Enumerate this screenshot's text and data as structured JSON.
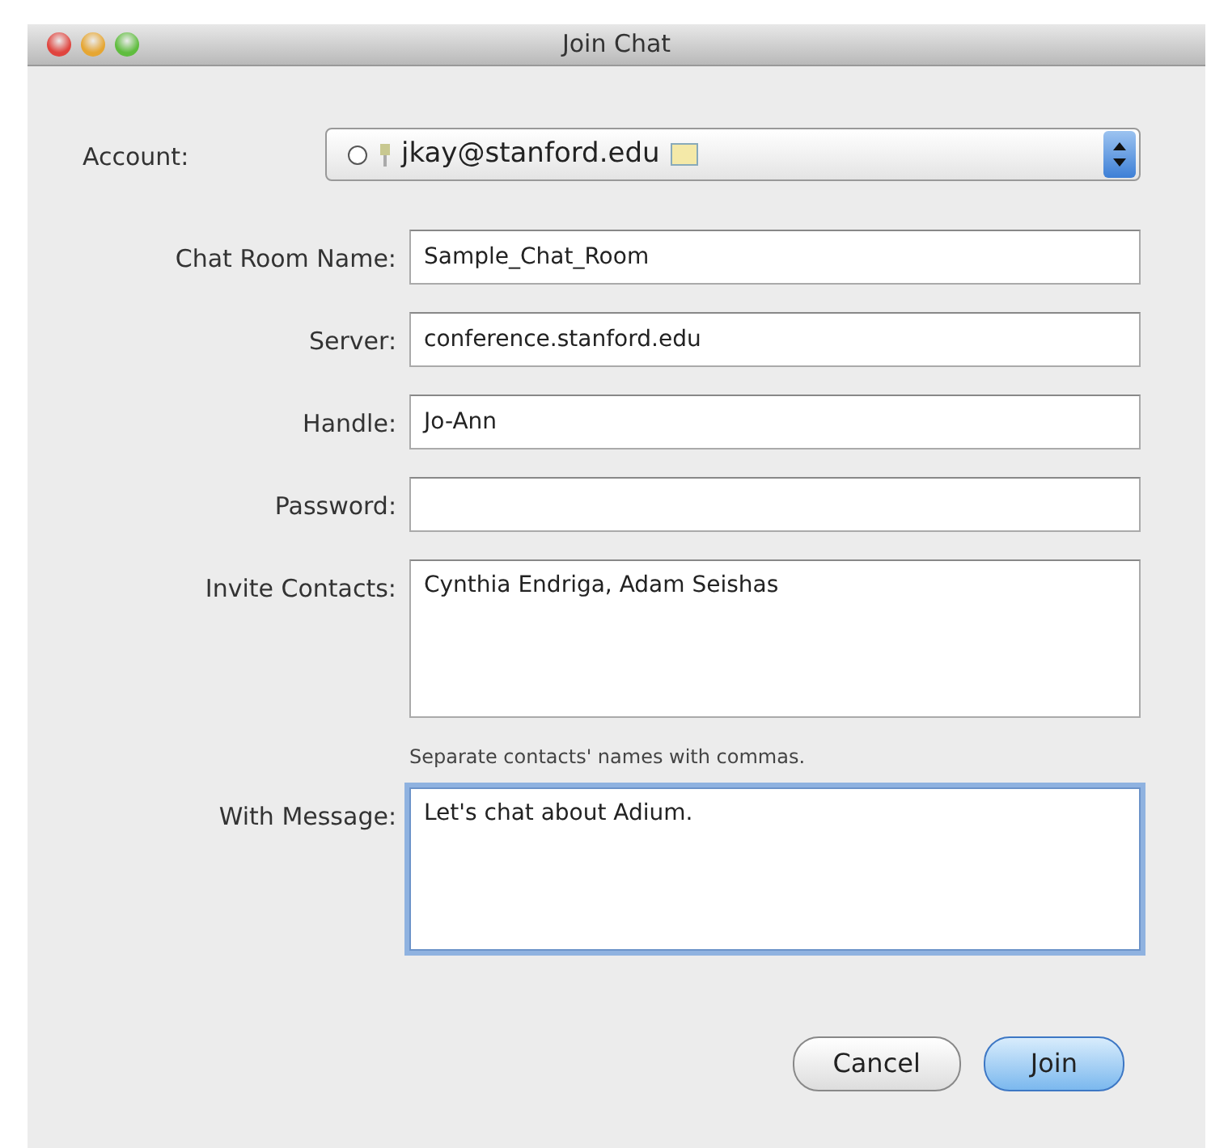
{
  "window": {
    "title": "Join Chat"
  },
  "account": {
    "label": "Account:",
    "value": "jkay@stanford.edu"
  },
  "fields": [
    {
      "label": "Chat Room Name:",
      "kind": "line",
      "value": "Sample_Chat_Room",
      "focused": false
    },
    {
      "label": "Server:",
      "kind": "line",
      "value": "conference.stanford.edu",
      "focused": false
    },
    {
      "label": "Handle:",
      "kind": "line",
      "value": "Jo-Ann",
      "focused": false
    },
    {
      "label": "Password:",
      "kind": "password",
      "focused": false
    },
    {
      "label": "Invite Contacts:",
      "kind": "area",
      "value": "Cynthia Endriga, Adam Seishas",
      "hint": "Separate contacts' names with commas.",
      "focused": false
    },
    {
      "label": "With Message:",
      "kind": "area",
      "value": "Let's chat about Adium.",
      "focused": true
    }
  ],
  "buttons": [
    {
      "label": "Cancel",
      "default": false
    },
    {
      "label": "Join",
      "default": true
    }
  ]
}
